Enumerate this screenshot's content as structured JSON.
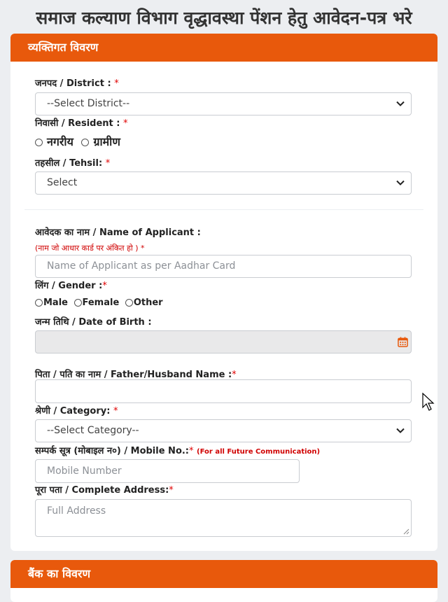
{
  "page": {
    "title": "समाज कल्याण विभाग वृद्धावस्था पेंशन हेतु आवेदन-पत्र भरे"
  },
  "personal_section": {
    "header": "व्यक्तिगत विवरण",
    "district": {
      "label": "जनपद / District :",
      "required_mark": "*",
      "selected": "--Select District--"
    },
    "resident": {
      "label": "निवासी / Resident :",
      "required_mark": "*",
      "options": [
        "नगरीय",
        "ग्रामीण"
      ]
    },
    "tehsil": {
      "label": "तहसील / Tehsil:",
      "required_mark": "*",
      "selected": "Select"
    },
    "applicant_name": {
      "label": "आवेदक का नाम / Name of Applicant :",
      "note": "(नाम जो आधार कार्ड पर अंकित हो )",
      "note_mark": "*",
      "placeholder": "Name of Applicant as per Aadhar Card"
    },
    "gender": {
      "label": "लिंग / Gender :",
      "required_mark": "*",
      "options": [
        "Male",
        "Female",
        "Other"
      ]
    },
    "dob": {
      "label": "जन्म तिथि / Date of Birth :"
    },
    "father_name": {
      "label": "पिता / पति का नाम / Father/Husband Name :",
      "required_mark": "*"
    },
    "category": {
      "label": "श्रेणी / Category:",
      "required_mark": "*",
      "selected": "--Select Category--"
    },
    "mobile": {
      "label": "सम्पर्क सूत्र (मोबाइल न०) / Mobile No.:",
      "required_mark": "*",
      "note": "(For all Future Communication)",
      "placeholder": "Mobile Number"
    },
    "address": {
      "label": "पूरा पता / Complete Address:",
      "required_mark": "*",
      "placeholder": "Full Address"
    }
  },
  "bank_section": {
    "header": "बैंक का विवरण"
  },
  "icons": {
    "dropdown": "chevron-down-icon",
    "calendar": "calendar-icon",
    "cursor": "mouse-cursor-icon"
  },
  "colors": {
    "header_bg": "#e8590c",
    "required": "#e00000",
    "calendar": "#e8590c"
  }
}
